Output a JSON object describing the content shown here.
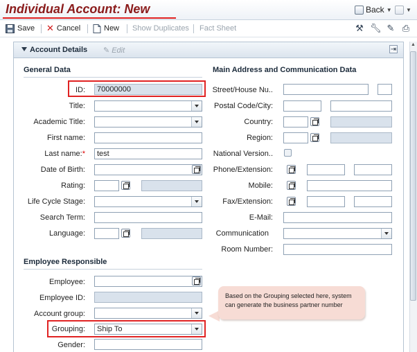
{
  "title": "Individual Account: New",
  "nav": {
    "back_label": "Back"
  },
  "toolbar": {
    "save_label": "Save",
    "cancel_label": "Cancel",
    "new_label": "New",
    "show_duplicates_label": "Show Duplicates",
    "fact_sheet_label": "Fact Sheet"
  },
  "panel": {
    "title": "Account Details",
    "edit_label": "Edit"
  },
  "general": {
    "header": "General Data",
    "id_label": "ID:",
    "id_value": "70000000",
    "title_label": "Title:",
    "title_value": "",
    "academic_label": "Academic Title:",
    "academic_value": "",
    "first_label": "First name:",
    "first_value": "",
    "last_label": "Last name:",
    "last_req": "*",
    "last_value": "test",
    "dob_label": "Date of Birth:",
    "dob_value": "",
    "rating_label": "Rating:",
    "rating_value": "",
    "lifecycle_label": "Life Cycle Stage:",
    "lifecycle_value": "",
    "search_label": "Search Term:",
    "search_value": "",
    "language_label": "Language:",
    "language_value": ""
  },
  "address": {
    "header": "Main Address and Communication Data",
    "street_label": "Street/House Nu..",
    "postal_label": "Postal Code/City:",
    "country_label": "Country:",
    "region_label": "Region:",
    "natver_label": "National Version..",
    "phone_label": "Phone/Extension:",
    "mobile_label": "Mobile:",
    "fax_label": "Fax/Extension:",
    "email_label": "E-Mail:",
    "comm_label": "Communication",
    "room_label": "Room Number:"
  },
  "employee": {
    "header": "Employee Responsible",
    "employee_label": "Employee:",
    "employee_id_label": "Employee ID:",
    "account_group_label": "Account group:",
    "grouping_label": "Grouping:",
    "grouping_value": "Ship To",
    "gender_label": "Gender:"
  },
  "callout": {
    "text": "Based on the Grouping selected here, system can generate the business partner number"
  }
}
